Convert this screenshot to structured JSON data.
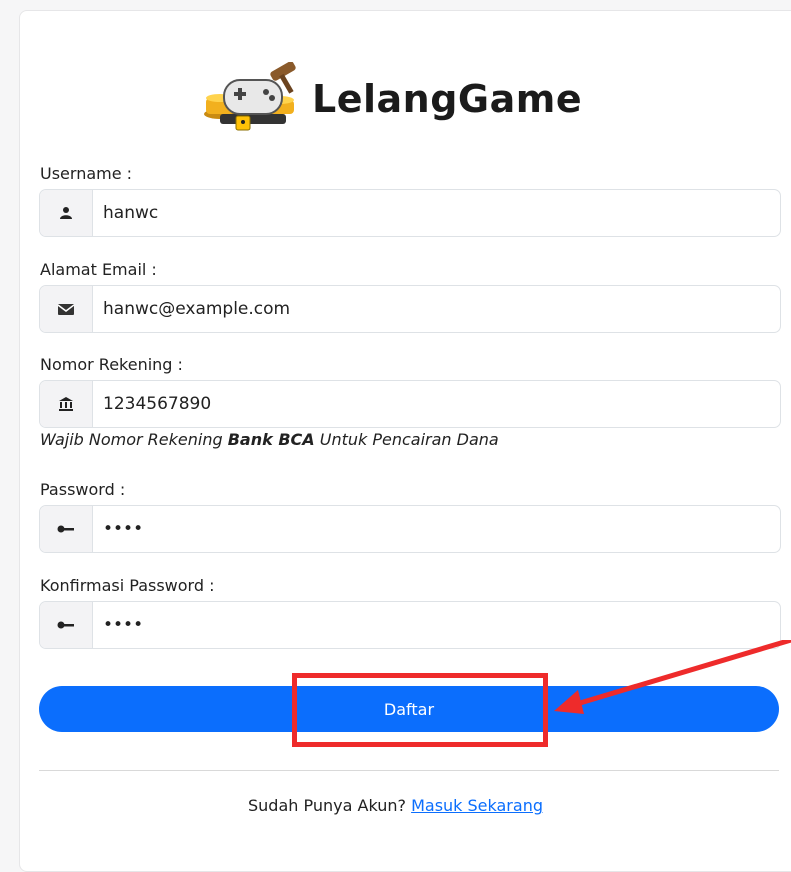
{
  "brand": {
    "title": "LelangGame",
    "logo_icon": "gamepad-auction-icon"
  },
  "form": {
    "username": {
      "label": "Username :",
      "value": "hanwc",
      "icon": "user-icon"
    },
    "email": {
      "label": "Alamat Email :",
      "value": "hanwc@example.com",
      "icon": "envelope-icon"
    },
    "account": {
      "label": "Nomor Rekening :",
      "value": "1234567890",
      "icon": "bank-icon",
      "note_prefix": "Wajib Nomor Rekening ",
      "note_bold": "Bank BCA",
      "note_suffix": " Untuk Pencairan Dana"
    },
    "password": {
      "label": "Password :",
      "value": "••••",
      "icon": "key-icon"
    },
    "confirm": {
      "label": "Konfirmasi Password :",
      "value": "••••",
      "icon": "key-icon"
    },
    "submit_label": "Daftar"
  },
  "footer": {
    "text": "Sudah Punya Akun? ",
    "link": "Masuk Sekarang"
  },
  "colors": {
    "primary": "#0b6efd",
    "highlight": "#ee2b2b"
  }
}
